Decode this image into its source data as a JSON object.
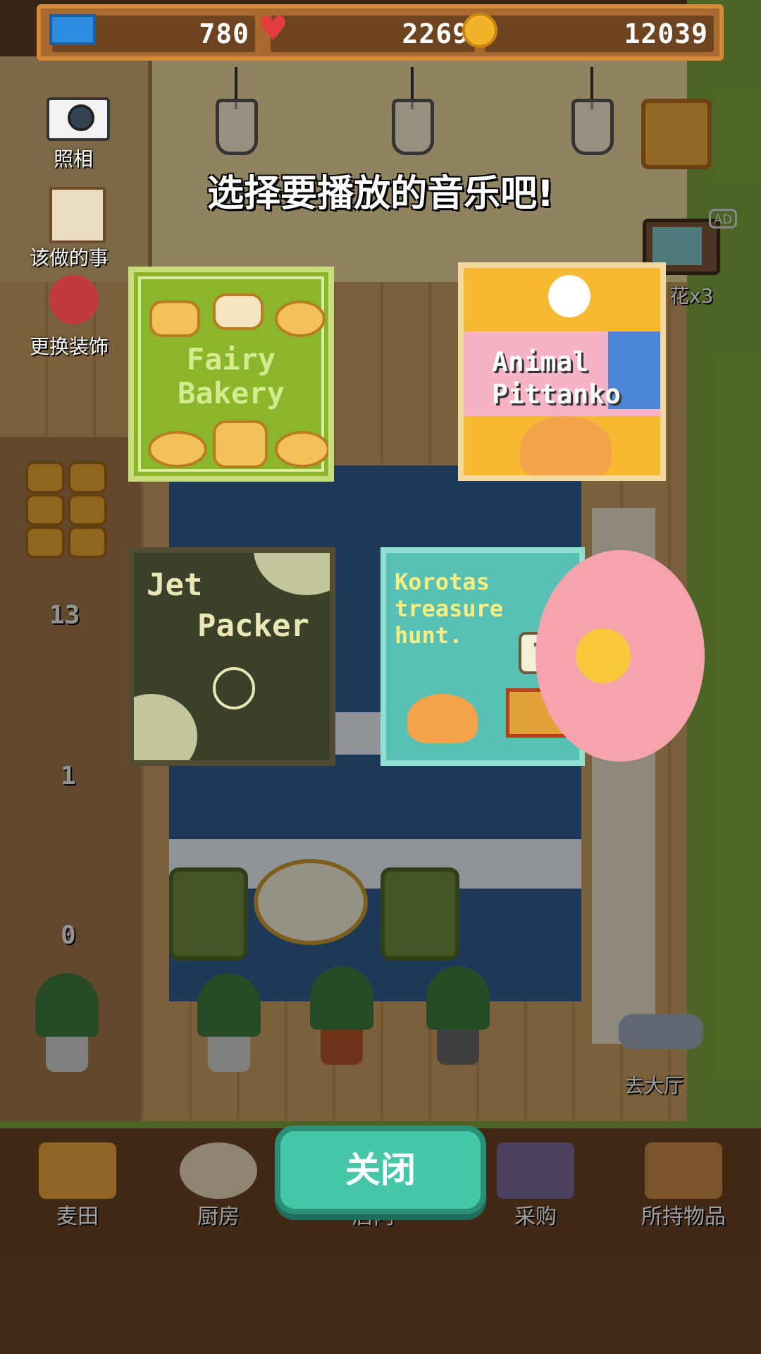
{
  "top_bar": {
    "tickets": "780",
    "hearts": "2269",
    "coins": "12039"
  },
  "side_menu": {
    "photo": "照相",
    "todo": "该做的事",
    "decorate": "更换装饰",
    "flowers": "花x3",
    "ad_badge": "AD",
    "to_hall": "去大厅"
  },
  "prompt": "选择要播放的音乐吧!",
  "albums": [
    {
      "id": "fairy-bakery",
      "title_line1": "Fairy",
      "title_line2": "Bakery"
    },
    {
      "id": "animal-pittanko",
      "title_line1": "Animal",
      "title_line2": "Pittanko"
    },
    {
      "id": "jet-packer",
      "title_line1": "Jet",
      "title_line2": "Packer"
    },
    {
      "id": "korotas-treasure-hunt",
      "title_line1": "Korotas",
      "title_line2": "treasure",
      "title_line3": "hunt."
    }
  ],
  "counters": {
    "shelf_top": "13",
    "shelf_mid": "1",
    "shelf_bottom": "0"
  },
  "close_button": "关闭",
  "bottom_nav": [
    {
      "label": "麦田",
      "icon": "wheat-icon"
    },
    {
      "label": "厨房",
      "icon": "kitchen-icon"
    },
    {
      "label": "店内",
      "icon": "shop-icon"
    },
    {
      "label": "采购",
      "icon": "purchase-icon"
    },
    {
      "label": "所持物品",
      "icon": "box-icon"
    }
  ]
}
